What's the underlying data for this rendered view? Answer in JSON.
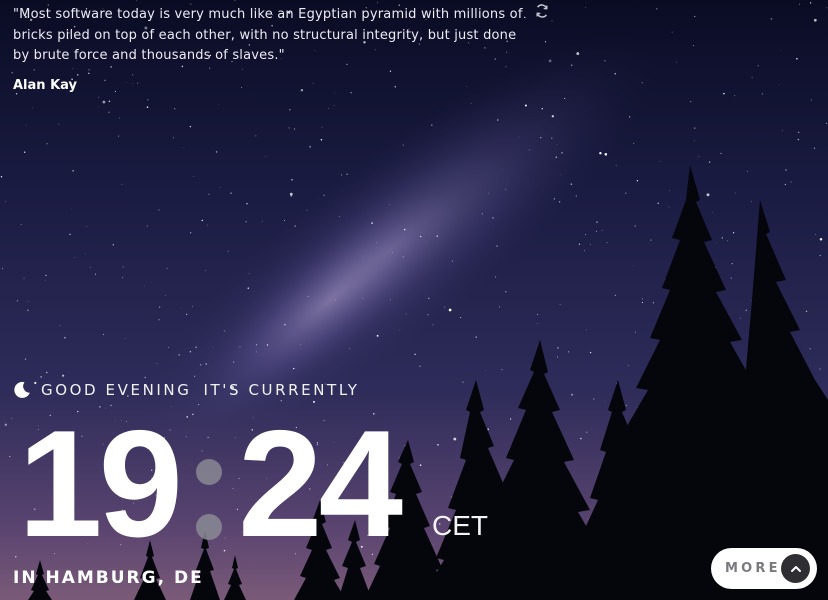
{
  "quote": {
    "text": "\"Most software today is very much like an Egyptian pyramid with millions of bricks piled on top of each other, with no structural integrity, but just done by brute force and thousands of slaves.\"",
    "author": "Alan Kay",
    "refresh_icon": "refresh-icon"
  },
  "greeting": {
    "icon": "moon-icon",
    "salutation": "GOOD EVENING",
    "suffix": "IT'S CURRENTLY"
  },
  "clock": {
    "hours": "19",
    "minutes": "24",
    "timezone": "CET"
  },
  "location": "IN HAMBURG, DE",
  "more_button": {
    "label": "MORE",
    "icon": "chevron-up-icon"
  },
  "colors": {
    "sky_top": "#0b0d26",
    "sky_mid": "#2b2a55",
    "horizon": "#6a4a72",
    "tree_silhouette": "#05060c",
    "button_bg": "#ffffff",
    "button_text": "#7a7a7e",
    "arrow_bg": "#2f2f33"
  }
}
